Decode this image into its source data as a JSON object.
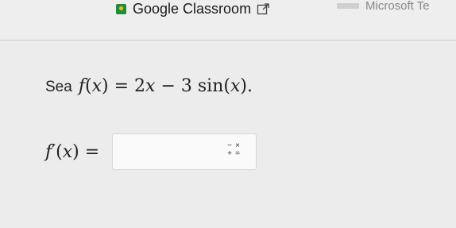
{
  "header": {
    "classroom_label": "Google Classroom",
    "microsoft_label": "Microsoft Te"
  },
  "problem": {
    "prompt_word": "Sea",
    "function_tex": "f(x) = 2x − 3 sin(x)."
  },
  "answer": {
    "label_tex": "f′(x) =",
    "value": "",
    "keypad_symbols": [
      "−",
      "×",
      "+",
      "="
    ]
  }
}
